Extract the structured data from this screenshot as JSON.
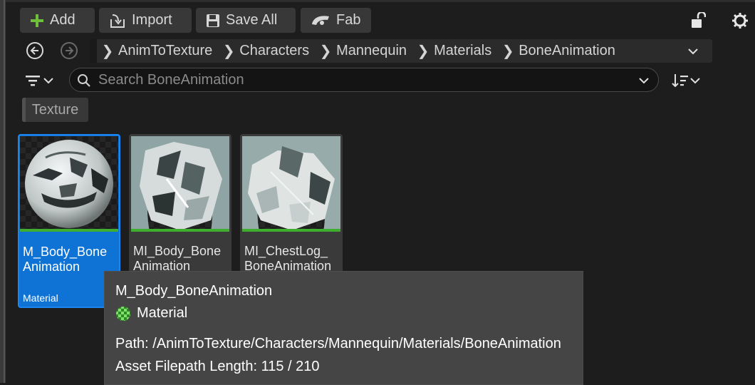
{
  "toolbar": {
    "add_label": "Add",
    "import_label": "Import",
    "save_all_label": "Save All",
    "fab_label": "Fab"
  },
  "breadcrumb": [
    "AnimToTexture",
    "Characters",
    "Mannequin",
    "Materials",
    "BoneAnimation"
  ],
  "search": {
    "value": "",
    "placeholder": "Search BoneAnimation"
  },
  "filter_chip": "Texture",
  "assets": [
    {
      "name": "M_Body_Bone\nAnimation",
      "type": "Material",
      "selected": true
    },
    {
      "name": "MI_Body_Bone\nAnimation",
      "type": "",
      "selected": false
    },
    {
      "name": "MI_ChestLog_\nBoneAnimation",
      "type": "",
      "selected": false
    }
  ],
  "tooltip": {
    "title": "M_Body_BoneAnimation",
    "type": "Material",
    "path_line": "Path: /AnimToTexture/Characters/Mannequin/Materials/BoneAnimation",
    "length_line": "Asset Filepath Length: 115 / 210"
  },
  "colors": {
    "selection": "#0f73d6",
    "asset_type_bar": "#3fae2f",
    "add_icon": "#6fbf3a"
  }
}
